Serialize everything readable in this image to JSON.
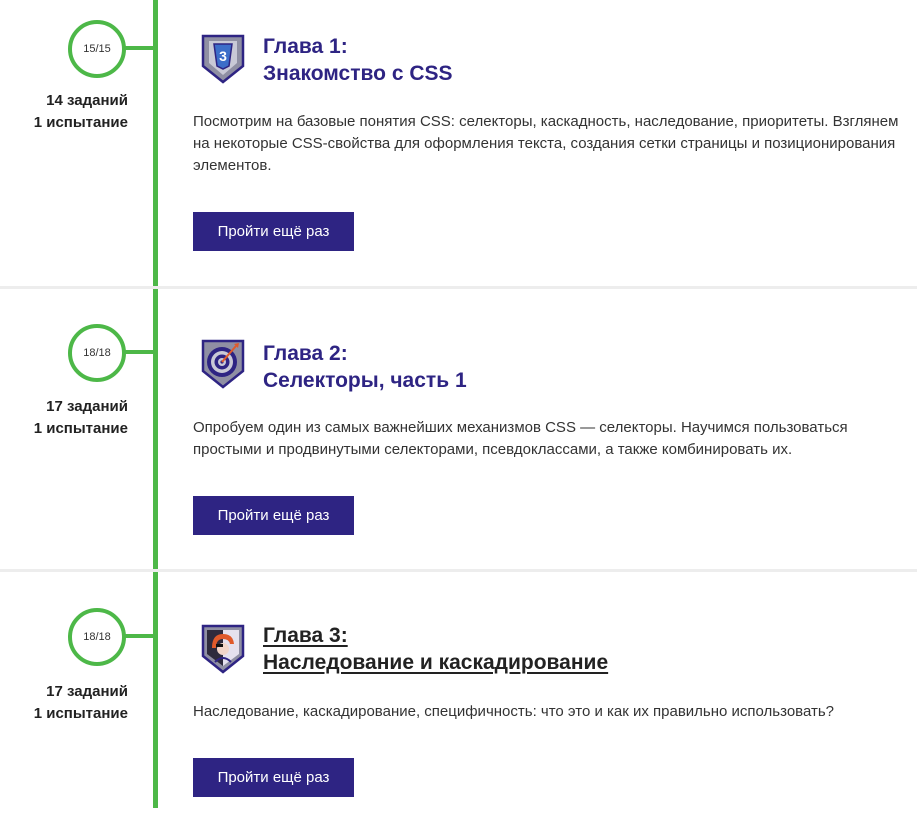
{
  "chapters": [
    {
      "progress": "15/15",
      "tasks": "14 заданий",
      "trials": "1 испытание",
      "title_line1": "Глава 1:",
      "title_line2": "Знакомство с CSS",
      "description": "Посмотрим на базовые понятия CSS: селекторы, каскадность, наследование, приоритеты. Взглянем на некоторые CSS-свойства для оформления текста, создания сетки страницы и позиционирования элементов.",
      "button_label": "Пройти ещё раз",
      "icon": "css3-shield-icon"
    },
    {
      "progress": "18/18",
      "tasks": "17 заданий",
      "trials": "1 испытание",
      "title_line1": "Глава 2:",
      "title_line2": "Селекторы, часть 1",
      "description": "Опробуем один из самых важнейших механизмов CSS — селекторы. Научимся пользоваться простыми и продвинутыми селекторами, псевдоклассами, а также комбинировать их.",
      "button_label": "Пройти ещё раз",
      "icon": "target-arrow-icon"
    },
    {
      "progress": "18/18",
      "tasks": "17 заданий",
      "trials": "1 испытание",
      "title_line1": "Глава 3:",
      "title_line2": "Наследование и каскадирование",
      "description": "Наследование, каскадирование, специфичность: что это и как их правильно использовать?",
      "button_label": "Пройти ещё раз",
      "icon": "helmet-portrait-icon"
    }
  ],
  "colors": {
    "timeline": "#4db848",
    "accent": "#2e2483",
    "divider": "#ededed"
  }
}
